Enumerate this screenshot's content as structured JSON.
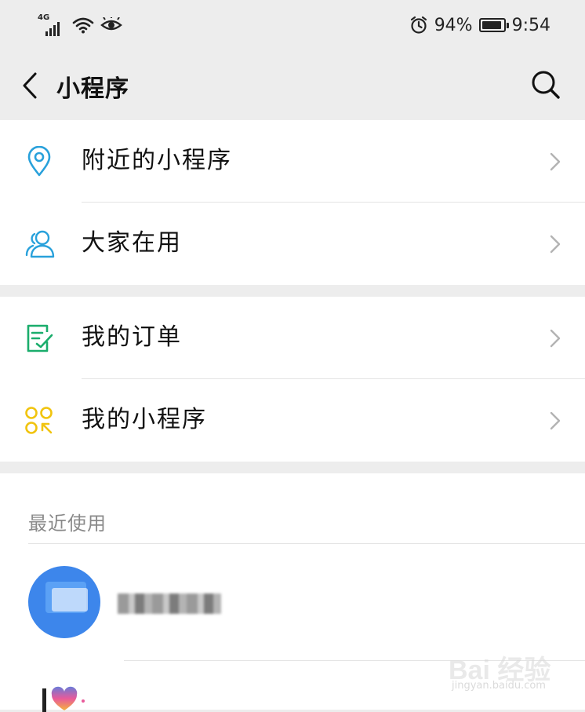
{
  "status_bar": {
    "network": "4G",
    "battery_percent": "94%",
    "battery_level": 0.94,
    "time": "9:54",
    "icons": [
      "signal-icon",
      "wifi-icon",
      "eye-icon",
      "alarm-icon",
      "battery-icon"
    ]
  },
  "header": {
    "title": "小程序",
    "back_icon": "chevron-left-icon",
    "search_icon": "search-icon"
  },
  "menu_groups": [
    {
      "items": [
        {
          "label": "附近的小程序",
          "icon": "location-pin-icon",
          "color": "#29a1db"
        },
        {
          "label": "大家在用",
          "icon": "people-icon",
          "color": "#29a1db"
        }
      ]
    },
    {
      "items": [
        {
          "label": "我的订单",
          "icon": "order-checklist-icon",
          "color": "#1aad6c"
        },
        {
          "label": "我的小程序",
          "icon": "my-miniprogram-icon",
          "color": "#f1c40f"
        }
      ]
    }
  ],
  "recent": {
    "title": "最近使用",
    "items": [
      {
        "name": "",
        "icon": "blue-card-app-icon"
      },
      {
        "name": "",
        "icon": "heart-logo-app-icon"
      }
    ]
  },
  "watermark": {
    "brand": "Bai 经验",
    "url": "jingyan.baidu.com"
  },
  "colors": {
    "background": "#ededed",
    "surface": "#ffffff",
    "divider": "#e4e4e4",
    "secondary_text": "#8a8a8a"
  }
}
